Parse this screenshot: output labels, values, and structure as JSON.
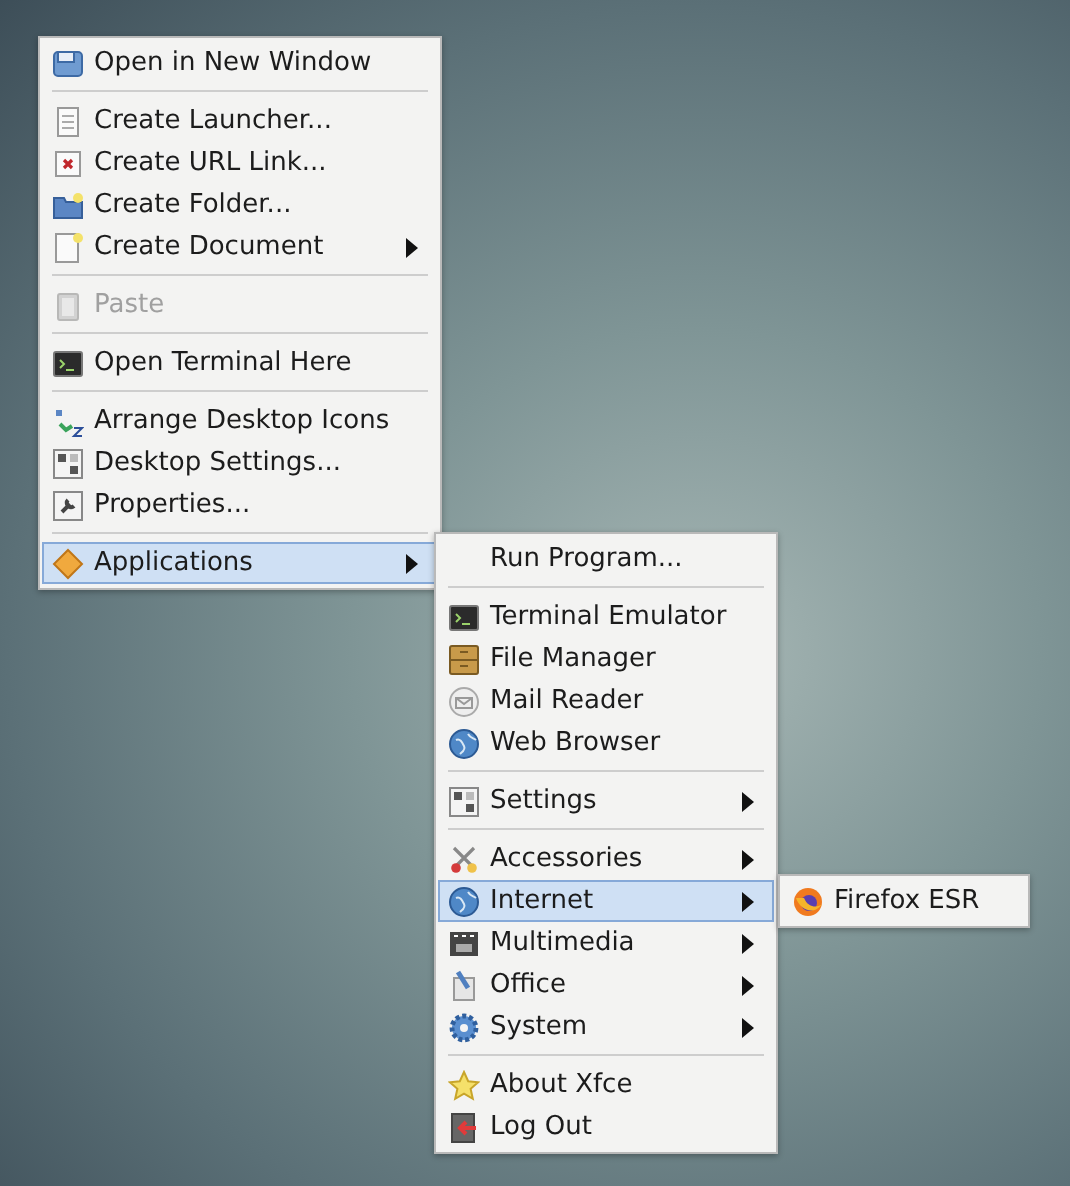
{
  "menus": [
    {
      "items": [
        {
          "kind": "item",
          "label": "Open in New Window",
          "submenu": false,
          "disabled": false,
          "selected": false
        },
        {
          "kind": "separator"
        },
        {
          "kind": "item",
          "label": "Create Launcher...",
          "submenu": false,
          "disabled": false,
          "selected": false
        },
        {
          "kind": "item",
          "label": "Create URL Link...",
          "submenu": false,
          "disabled": false,
          "selected": false
        },
        {
          "kind": "item",
          "label": "Create Folder...",
          "submenu": false,
          "disabled": false,
          "selected": false
        },
        {
          "kind": "item",
          "label": "Create Document",
          "submenu": true,
          "disabled": false,
          "selected": false
        },
        {
          "kind": "separator"
        },
        {
          "kind": "item",
          "label": "Paste",
          "submenu": false,
          "disabled": true,
          "selected": false
        },
        {
          "kind": "separator"
        },
        {
          "kind": "item",
          "label": "Open Terminal Here",
          "submenu": false,
          "disabled": false,
          "selected": false
        },
        {
          "kind": "separator"
        },
        {
          "kind": "item",
          "label": "Arrange Desktop Icons",
          "submenu": false,
          "disabled": false,
          "selected": false
        },
        {
          "kind": "item",
          "label": "Desktop Settings...",
          "submenu": false,
          "disabled": false,
          "selected": false
        },
        {
          "kind": "item",
          "label": "Properties...",
          "submenu": false,
          "disabled": false,
          "selected": false
        },
        {
          "kind": "separator"
        },
        {
          "kind": "item",
          "label": "Applications",
          "submenu": true,
          "disabled": false,
          "selected": true
        }
      ]
    },
    {
      "items": [
        {
          "kind": "item",
          "label": "Run Program...",
          "submenu": false,
          "disabled": false,
          "selected": false
        },
        {
          "kind": "separator"
        },
        {
          "kind": "item",
          "label": "Terminal Emulator",
          "submenu": false,
          "disabled": false,
          "selected": false
        },
        {
          "kind": "item",
          "label": "File Manager",
          "submenu": false,
          "disabled": false,
          "selected": false
        },
        {
          "kind": "item",
          "label": "Mail Reader",
          "submenu": false,
          "disabled": false,
          "selected": false
        },
        {
          "kind": "item",
          "label": "Web Browser",
          "submenu": false,
          "disabled": false,
          "selected": false
        },
        {
          "kind": "separator"
        },
        {
          "kind": "item",
          "label": "Settings",
          "submenu": true,
          "disabled": false,
          "selected": false
        },
        {
          "kind": "separator"
        },
        {
          "kind": "item",
          "label": "Accessories",
          "submenu": true,
          "disabled": false,
          "selected": false
        },
        {
          "kind": "item",
          "label": "Internet",
          "submenu": true,
          "disabled": false,
          "selected": true
        },
        {
          "kind": "item",
          "label": "Multimedia",
          "submenu": true,
          "disabled": false,
          "selected": false
        },
        {
          "kind": "item",
          "label": "Office",
          "submenu": true,
          "disabled": false,
          "selected": false
        },
        {
          "kind": "item",
          "label": "System",
          "submenu": true,
          "disabled": false,
          "selected": false
        },
        {
          "kind": "separator"
        },
        {
          "kind": "item",
          "label": "About Xfce",
          "submenu": false,
          "disabled": false,
          "selected": false
        },
        {
          "kind": "item",
          "label": "Log Out",
          "submenu": false,
          "disabled": false,
          "selected": false
        }
      ]
    },
    {
      "items": [
        {
          "kind": "item",
          "label": "Firefox ESR",
          "submenu": false,
          "disabled": false,
          "selected": false
        }
      ]
    }
  ]
}
